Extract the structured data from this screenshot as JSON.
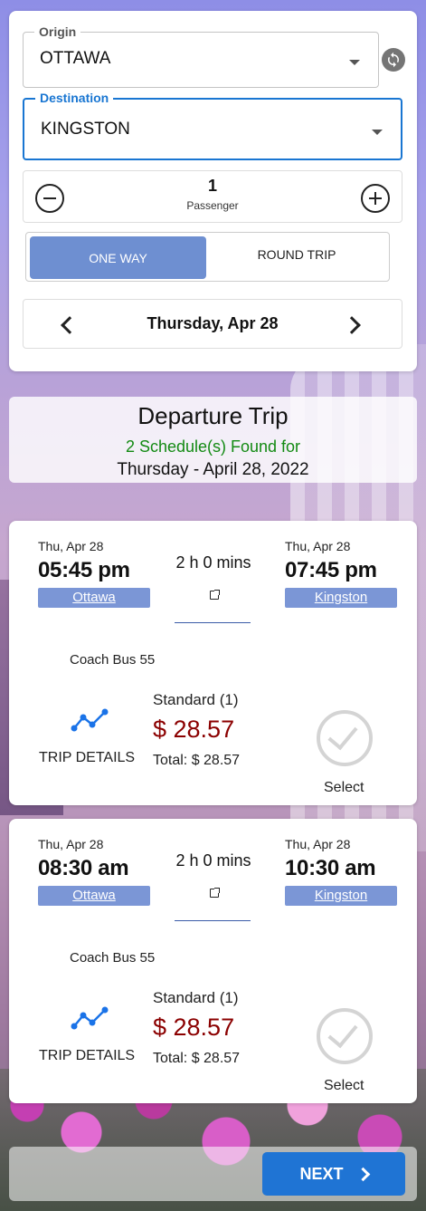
{
  "colors": {
    "primary": "#1976d2",
    "toggle_active": "#6e8fd1",
    "city_badge": "#7b96d6",
    "price": "#8b0000",
    "found_text": "#138a13",
    "next_button": "#1f74d4"
  },
  "search": {
    "origin": {
      "label": "Origin",
      "value": "OTTAWA"
    },
    "destination": {
      "label": "Destination",
      "value": "KINGSTON"
    },
    "passengers": {
      "count": "1",
      "label": "Passenger"
    },
    "trip_type": {
      "one_way": "ONE WAY",
      "round_trip": "ROUND TRIP",
      "selected": "ONE WAY"
    },
    "date": "Thursday, Apr 28"
  },
  "results": {
    "title": "Departure Trip",
    "found": "2 Schedule(s) Found for",
    "date": "Thursday - April 28, 2022"
  },
  "schedules": [
    {
      "dep_date": "Thu, Apr 28",
      "dep_time": "05:45 pm",
      "dep_city": "Ottawa",
      "arr_date": "Thu, Apr 28",
      "arr_time": "07:45 pm",
      "arr_city": "Kingston",
      "duration": "2 h 0 mins",
      "bus": "Coach Bus 55",
      "trip_details": "TRIP DETAILS",
      "fare": "Standard (1)",
      "price": "$ 28.57",
      "total": "Total: $ 28.57",
      "select": "Select"
    },
    {
      "dep_date": "Thu, Apr 28",
      "dep_time": "08:30 am",
      "dep_city": "Ottawa",
      "arr_date": "Thu, Apr 28",
      "arr_time": "10:30 am",
      "arr_city": "Kingston",
      "duration": "2 h 0 mins",
      "bus": "Coach Bus 55",
      "trip_details": "TRIP DETAILS",
      "fare": "Standard (1)",
      "price": "$ 28.57",
      "total": "Total: $ 28.57",
      "select": "Select"
    }
  ],
  "footer": {
    "next_label": "NEXT"
  }
}
